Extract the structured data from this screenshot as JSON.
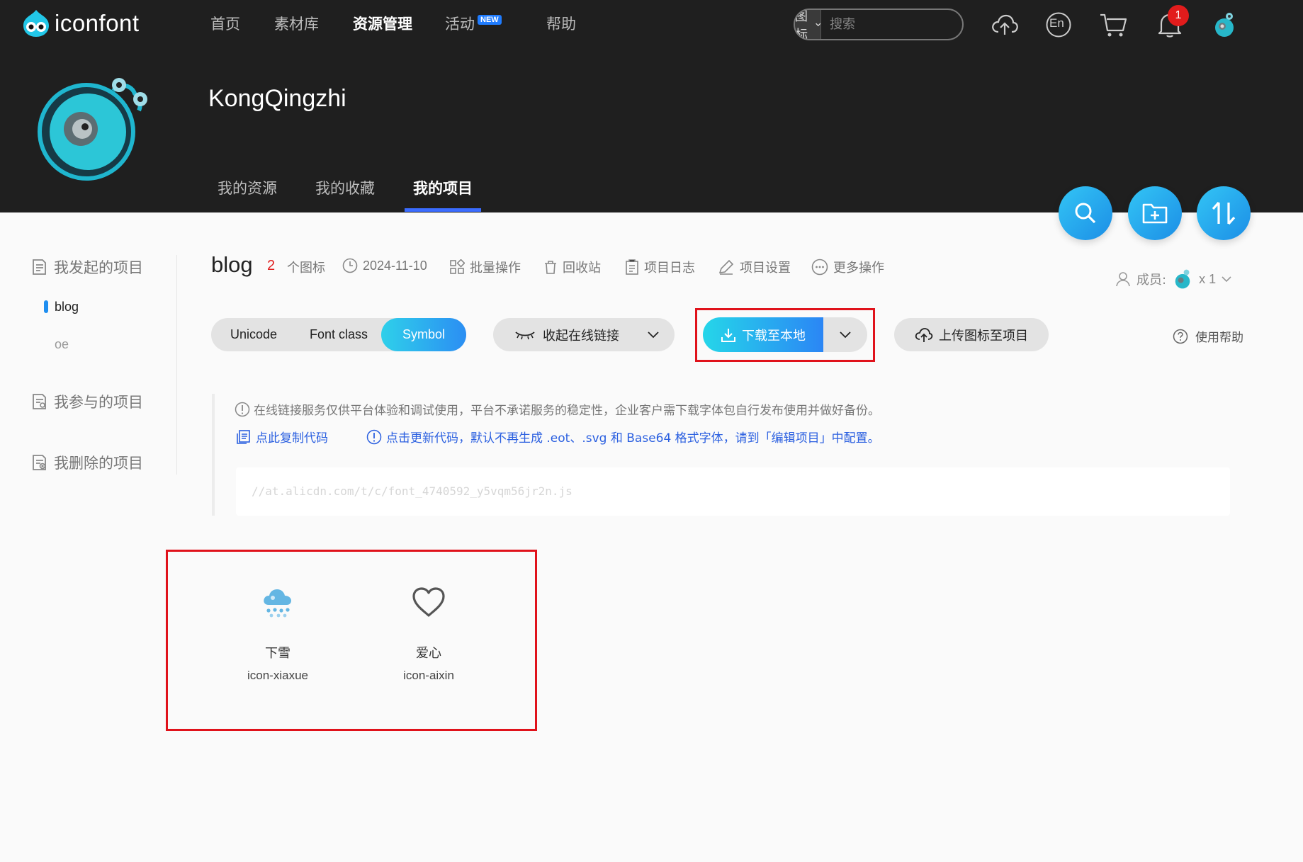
{
  "app": {
    "brand": "iconfont"
  },
  "topnav": [
    {
      "label": "首页"
    },
    {
      "label": "素材库"
    },
    {
      "label": "资源管理",
      "active": true
    },
    {
      "label": "活动",
      "badge": "NEW"
    },
    {
      "label": "帮助"
    }
  ],
  "search": {
    "type_label": "图标",
    "placeholder": "搜索"
  },
  "header_icons": [
    "upload-cloud-icon",
    "language-en-icon",
    "cart-icon",
    "bell-icon",
    "avatar"
  ],
  "notifications": {
    "count": "1"
  },
  "lang": {
    "label": "En"
  },
  "profile": {
    "username": "KongQingzhi"
  },
  "subnav": [
    {
      "label": "我的资源"
    },
    {
      "label": "我的收藏"
    },
    {
      "label": "我的项目",
      "active": true
    }
  ],
  "sidebar": {
    "sections": [
      {
        "label": "我发起的项目",
        "items": [
          {
            "label": "blog",
            "active": true
          },
          {
            "label": "oe"
          }
        ]
      },
      {
        "label": "我参与的项目"
      },
      {
        "label": "我删除的项目"
      }
    ]
  },
  "project": {
    "title": "blog",
    "icon_count": "2",
    "icon_count_suffix": "个图标",
    "date": "2024-11-10",
    "actions": [
      "批量操作",
      "回收站",
      "项目日志",
      "项目设置",
      "更多操作"
    ],
    "members_label": "成员:",
    "members_count": "x 1"
  },
  "toolbar": {
    "formats": [
      "Unicode",
      "Font class",
      "Symbol"
    ],
    "active_format": "Symbol",
    "collapse_label": "收起在线链接",
    "download_label": "下载至本地",
    "upload_label": "上传图标至项目",
    "help_label": "使用帮助"
  },
  "info": {
    "notice": "在线链接服务仅供平台体验和调试使用，平台不承诺服务的稳定性，企业客户需下载字体包自行发布使用并做好备份。",
    "copy_label": "点此复制代码",
    "update_label": "点击更新代码，默认不再生成 .eot、.svg 和 Base64 格式字体，请到「编辑项目」中配置。",
    "code": "//at.alicdn.com/t/c/font_4740592_y5vqm56jr2n.js"
  },
  "icons": [
    {
      "name": "下雪",
      "code": "icon-xiaxue",
      "glyph": "snow-cloud-icon",
      "color": "#4aa6dc"
    },
    {
      "name": "爱心",
      "code": "icon-aixin",
      "glyph": "heart-icon",
      "color": "#555555"
    }
  ],
  "colors": {
    "accent": "#2b8ef3",
    "cyan": "#25d6e9",
    "highlight": "#e0121b",
    "header_bg": "#1f1f1f"
  }
}
